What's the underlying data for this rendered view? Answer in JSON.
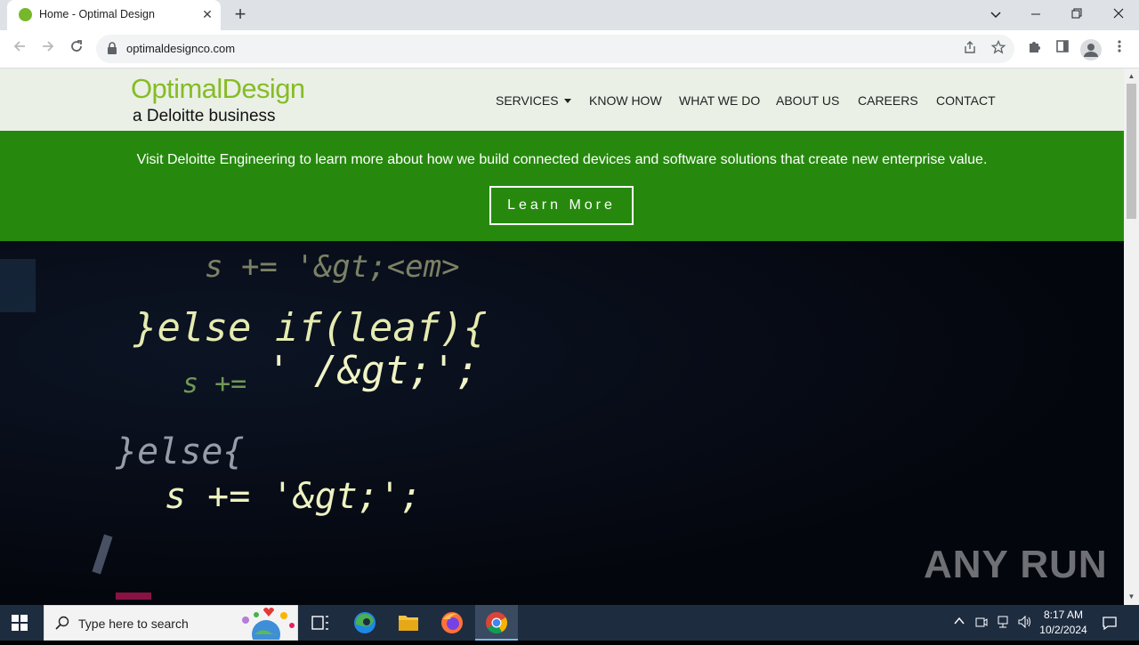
{
  "browser": {
    "tab_title": "Home - Optimal Design",
    "tab_close": "✕",
    "new_tab": "+",
    "url": "optimaldesignco.com"
  },
  "site": {
    "logo_main": "OptimalDesign",
    "logo_sub": "a Deloitte business",
    "nav": [
      "SERVICES",
      "KNOW HOW",
      "WHAT WE DO",
      "ABOUT US",
      "CAREERS",
      "CONTACT"
    ],
    "banner_text": "Visit Deloitte Engineering to learn more about how we build connected devices and software solutions that create new enterprise value.",
    "banner_button": "Learn More",
    "hero_code": [
      "s += '&gt;<em>",
      "}else if(leaf){",
      "' /&gt;';",
      "s +=",
      "}else{",
      "s += '&gt;';"
    ]
  },
  "watermark": "ANY RUN",
  "taskbar": {
    "search_placeholder": "Type here to search",
    "time": "8:17 AM",
    "date": "10/2/2024"
  },
  "colors": {
    "brand_green": "#86bc25",
    "banner_green": "#26890d",
    "header_bg": "#eaf0e6"
  }
}
